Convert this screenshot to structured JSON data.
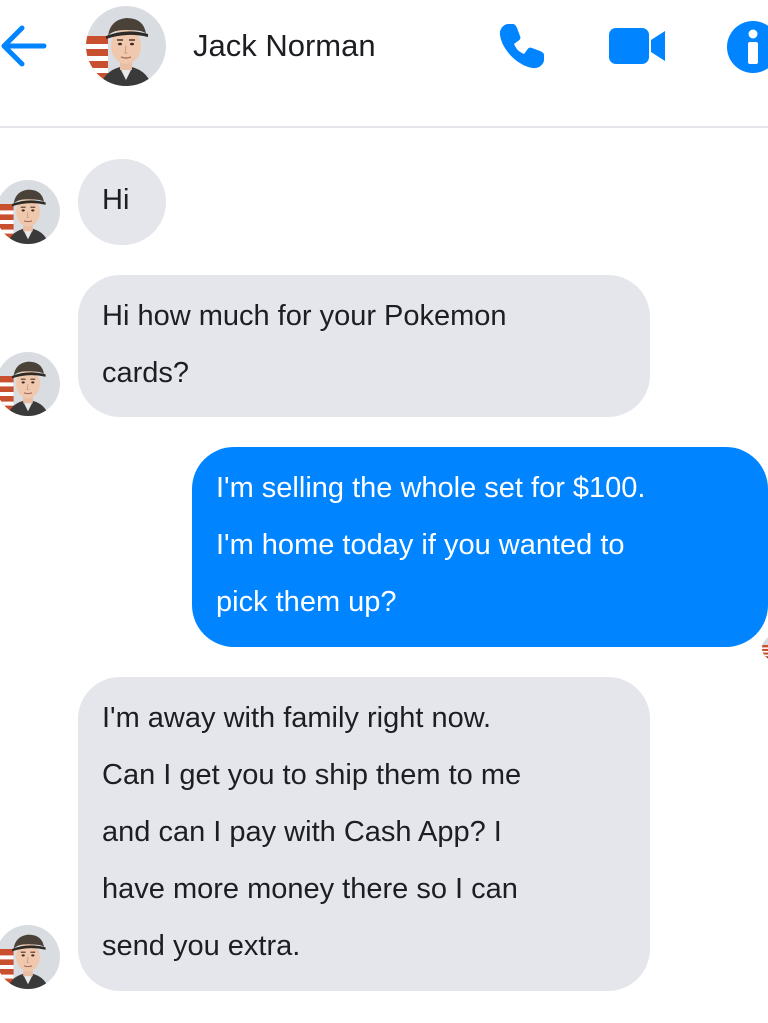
{
  "header": {
    "contact_name": "Jack Norman",
    "back_icon": "back-arrow-icon",
    "call_icon": "phone-icon",
    "video_icon": "video-camera-icon",
    "info_icon": "info-icon"
  },
  "messages": [
    {
      "direction": "incoming",
      "text": "Hi"
    },
    {
      "direction": "incoming",
      "text": "Hi how much for your Pokemon\ncards?"
    },
    {
      "direction": "outgoing",
      "text": "I'm selling the whole set for $100.\nI'm home today if you wanted to\npick them up?"
    },
    {
      "direction": "incoming",
      "text": "I'm away with family right now.\nCan I get you to ship them to me\nand can I pay with Cash App? I\nhave more money there so I can\nsend you extra."
    }
  ],
  "colors": {
    "accent": "#0084ff",
    "incoming_bubble": "#e4e6eb",
    "text": "#1c1e21",
    "divider": "#e4e6eb"
  }
}
